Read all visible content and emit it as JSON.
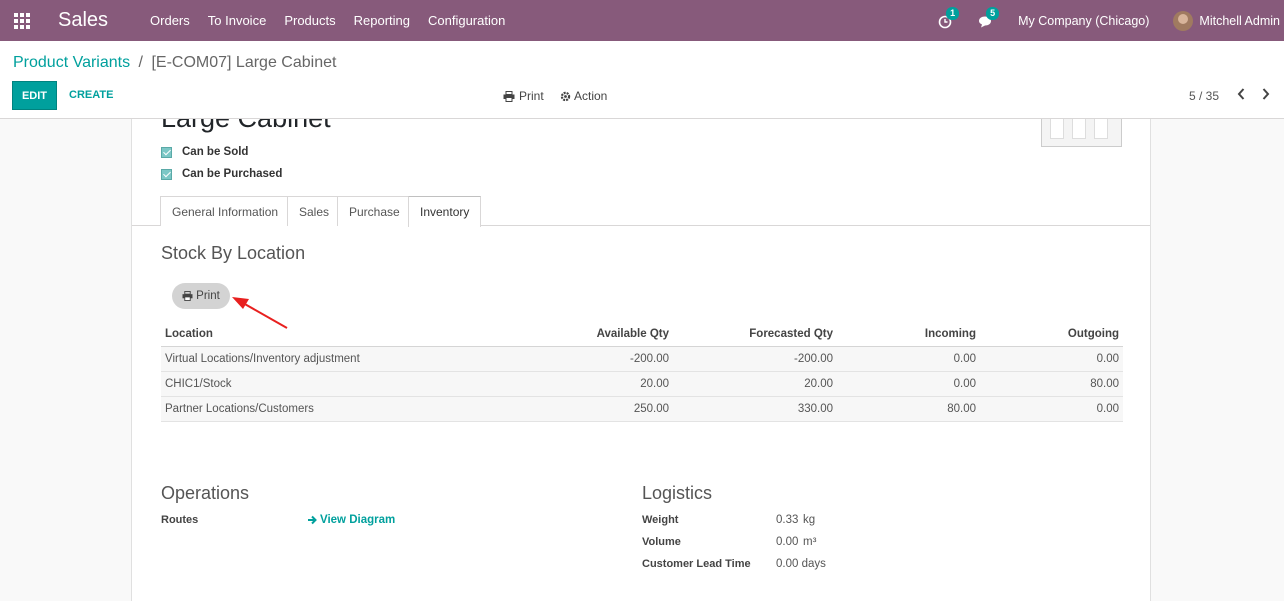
{
  "navbar": {
    "app_name": "Sales",
    "menu": [
      "Orders",
      "To Invoice",
      "Products",
      "Reporting",
      "Configuration"
    ],
    "activity_count": "1",
    "messages_count": "5",
    "company": "My Company (Chicago)",
    "user": "Mitchell Admin"
  },
  "breadcrumb": {
    "parent": "Product Variants",
    "separator": "/",
    "current": "[E-COM07] Large Cabinet"
  },
  "control_panel": {
    "edit_label": "EDIT",
    "create_label": "CREATE",
    "print_label": "Print",
    "action_label": "Action",
    "pager": "5 / 35"
  },
  "product": {
    "name": "Large Cabinet",
    "can_be_sold": "Can be Sold",
    "can_be_purchased": "Can be Purchased"
  },
  "tabs": [
    "General Information",
    "Sales",
    "Purchase",
    "Inventory"
  ],
  "stock": {
    "title": "Stock By Location",
    "print_label": "Print",
    "headers": [
      "Location",
      "Available Qty",
      "Forecasted Qty",
      "Incoming",
      "Outgoing"
    ],
    "rows": [
      [
        "Virtual Locations/Inventory adjustment",
        "-200.00",
        "-200.00",
        "0.00",
        "0.00"
      ],
      [
        "CHIC1/Stock",
        "20.00",
        "20.00",
        "0.00",
        "80.00"
      ],
      [
        "Partner Locations/Customers",
        "250.00",
        "330.00",
        "80.00",
        "0.00"
      ]
    ]
  },
  "operations": {
    "title": "Operations",
    "routes_label": "Routes",
    "view_diagram": "View Diagram"
  },
  "logistics": {
    "title": "Logistics",
    "weight_label": "Weight",
    "weight_value": "0.33",
    "weight_unit": "kg",
    "volume_label": "Volume",
    "volume_value": "0.00",
    "volume_unit": "m³",
    "lead_time_label": "Customer Lead Time",
    "lead_time_value": "0.00 days"
  },
  "colors": {
    "navbar": "#875a7b",
    "accent": "#00a09d",
    "annotation_arrow": "#e8201f"
  }
}
